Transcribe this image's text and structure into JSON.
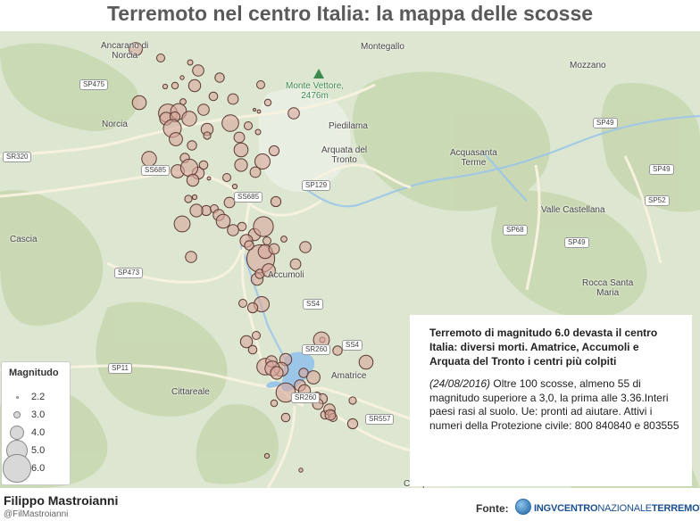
{
  "header": {
    "title": "Terremoto nel centro Italia: la mappa delle scosse"
  },
  "map": {
    "colors": {
      "water": "#9cc6e8",
      "land": "#dfe8d2",
      "forest": "#c9dab3",
      "river": "#ffffff",
      "road": "#f4f1e4",
      "quake_fill": "#d9a79c",
      "quake_stroke": "#5a3a32"
    },
    "places": [
      {
        "label": "Ancarano di\nNorcia",
        "type": "town"
      },
      {
        "label": "Montegallo",
        "type": "town"
      },
      {
        "label": "Mozzano",
        "type": "town"
      },
      {
        "label": "Monte Vettore,\n2476m",
        "type": "peak"
      },
      {
        "label": "Norcia",
        "type": "town"
      },
      {
        "label": "Piedilama",
        "type": "town"
      },
      {
        "label": "Arquata del\nTronto",
        "type": "town"
      },
      {
        "label": "Acquasanta\nTerme",
        "type": "town"
      },
      {
        "label": "Valle Castellana",
        "type": "town"
      },
      {
        "label": "Cascia",
        "type": "town"
      },
      {
        "label": "Accumoli",
        "type": "town"
      },
      {
        "label": "Rocca Santa\nMaria",
        "type": "town"
      },
      {
        "label": "Cittareale",
        "type": "town"
      },
      {
        "label": "Amatrice",
        "type": "town"
      },
      {
        "label": "Campotosto",
        "type": "town"
      }
    ],
    "roads": [
      "SP475",
      "SR320",
      "SS685",
      "SP129",
      "SP49",
      "SP49",
      "SP52",
      "SP68",
      "SP49",
      "SP473",
      "SS4",
      "SS4",
      "SP11",
      "SR260",
      "SR260",
      "SR557",
      "SS685"
    ],
    "quakes": [
      {
        "mag": 3.8
      },
      {
        "mag": 3.0
      },
      {
        "mag": 2.6
      },
      {
        "mag": 3.5
      },
      {
        "mag": 2.4
      },
      {
        "mag": 3.2
      },
      {
        "mag": 2.8
      },
      {
        "mag": 3.6
      },
      {
        "mag": 2.5
      },
      {
        "mag": 3.1
      },
      {
        "mag": 3.4
      },
      {
        "mag": 3.9
      },
      {
        "mag": 4.6
      },
      {
        "mag": 4.2
      },
      {
        "mag": 3.7
      },
      {
        "mag": 3.3
      },
      {
        "mag": 4.0
      },
      {
        "mag": 3.5
      },
      {
        "mag": 2.7
      },
      {
        "mag": 3.0
      },
      {
        "mag": 4.3
      },
      {
        "mag": 3.6
      },
      {
        "mag": 3.0
      },
      {
        "mag": 2.9
      },
      {
        "mag": 3.4
      },
      {
        "mag": 4.5
      },
      {
        "mag": 3.8
      },
      {
        "mag": 3.2
      },
      {
        "mag": 3.9
      },
      {
        "mag": 2.6
      },
      {
        "mag": 3.7
      },
      {
        "mag": 4.1
      },
      {
        "mag": 3.3
      },
      {
        "mag": 3.5
      },
      {
        "mag": 2.8
      },
      {
        "mag": 3.4
      },
      {
        "mag": 3.0
      },
      {
        "mag": 3.6
      },
      {
        "mag": 4.0
      },
      {
        "mag": 3.2
      },
      {
        "mag": 3.1
      },
      {
        "mag": 3.8
      },
      {
        "mag": 4.4
      },
      {
        "mag": 3.6
      },
      {
        "mag": 2.9
      },
      {
        "mag": 3.3
      },
      {
        "mag": 3.0
      },
      {
        "mag": 3.5
      },
      {
        "mag": 3.7
      },
      {
        "mag": 2.5
      },
      {
        "mag": 3.9
      },
      {
        "mag": 4.2
      },
      {
        "mag": 3.4
      },
      {
        "mag": 6.0
      },
      {
        "mag": 3.6
      },
      {
        "mag": 4.8
      },
      {
        "mag": 3.1
      },
      {
        "mag": 3.7
      },
      {
        "mag": 3.3
      },
      {
        "mag": 3.5
      },
      {
        "mag": 2.7
      },
      {
        "mag": 3.2
      },
      {
        "mag": 3.0
      },
      {
        "mag": 3.9
      },
      {
        "mag": 3.4
      },
      {
        "mag": 3.6
      },
      {
        "mag": 3.2
      },
      {
        "mag": 3.8
      },
      {
        "mag": 3.4
      },
      {
        "mag": 3.5
      },
      {
        "mag": 4.1
      },
      {
        "mag": 3.3
      },
      {
        "mag": 3.0
      },
      {
        "mag": 4.3
      },
      {
        "mag": 3.6
      },
      {
        "mag": 3.1
      },
      {
        "mag": 3.5
      },
      {
        "mag": 3.9
      },
      {
        "mag": 4.0
      },
      {
        "mag": 3.7
      },
      {
        "mag": 4.7
      },
      {
        "mag": 3.5
      },
      {
        "mag": 3.2
      },
      {
        "mag": 3.8
      },
      {
        "mag": 3.0
      },
      {
        "mag": 3.6
      },
      {
        "mag": 3.3
      },
      {
        "mag": 3.4
      },
      {
        "mag": 3.1
      },
      {
        "mag": 3.5
      },
      {
        "mag": 2.8
      },
      {
        "mag": 2.6
      },
      {
        "mag": 3.2
      },
      {
        "mag": 3.0
      },
      {
        "mag": 2.4
      },
      {
        "mag": 2.5
      },
      {
        "mag": 3.9
      },
      {
        "mag": 4.2
      },
      {
        "mag": 2.9
      },
      {
        "mag": 3.4
      },
      {
        "mag": 3.3
      },
      {
        "mag": 3.1
      },
      {
        "mag": 2.8
      },
      {
        "mag": 3.6
      },
      {
        "mag": 3.0
      },
      {
        "mag": 3.5
      },
      {
        "mag": 2.5
      },
      {
        "mag": 2.3
      },
      {
        "mag": 2.2
      },
      {
        "mag": 2.3
      }
    ]
  },
  "legend": {
    "title": "Magnitudo",
    "items": [
      {
        "label": "2.2",
        "mag": 2.2
      },
      {
        "label": "3.0",
        "mag": 3.0
      },
      {
        "label": "4.0",
        "mag": 4.0
      },
      {
        "label": "5.0",
        "mag": 5.0
      },
      {
        "label": "6.0",
        "mag": 6.0
      }
    ]
  },
  "info": {
    "headline": "Terremoto di magnitudo 6.0 devasta il centro Italia: diversi morti. Amatrice, Accumoli e Arquata del Tronto i centri più colpiti",
    "date": "(24/08/2016)",
    "body": "Oltre 100 scosse, almeno 55 di magnitudo superiore a 3,0, la prima alle 3.36.Interi paesi rasi al suolo. Ue: pronti ad aiutare. Attivi i numeri della Protezione civile: 800 840840 e 803555"
  },
  "footer": {
    "author": "Filippo Mastroianni",
    "handle": "@FilMastroianni",
    "source_label": "Fonte:",
    "source_ingv": "INGV",
    "source_centro": "CENTRO",
    "source_nazionale": "NAZIONALE",
    "source_terremoti": "TERREMOTI"
  }
}
